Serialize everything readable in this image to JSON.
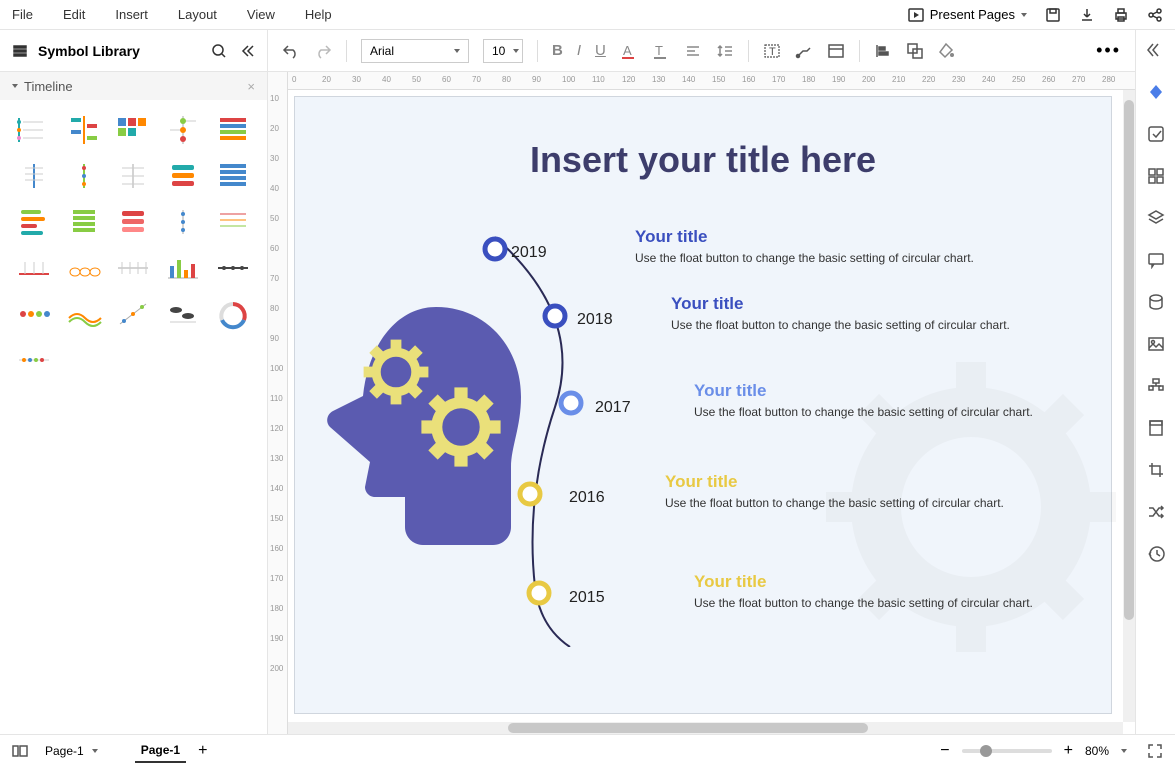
{
  "menu": {
    "file": "File",
    "edit": "Edit",
    "insert": "Insert",
    "layout": "Layout",
    "view": "View",
    "help": "Help"
  },
  "header": {
    "present": "Present Pages"
  },
  "sidebar": {
    "title": "Symbol Library",
    "panel": "Timeline"
  },
  "toolbar": {
    "font": "Arial",
    "size": "10"
  },
  "canvas": {
    "title": "Insert your title here",
    "entries": [
      {
        "year": "2019",
        "title": "Your title",
        "desc": "Use the float button to change the basic setting of circular chart.",
        "color": "#3a4fbf"
      },
      {
        "year": "2018",
        "title": "Your title",
        "desc": "Use the float button to change the basic setting of circular chart.",
        "color": "#3a4fbf"
      },
      {
        "year": "2017",
        "title": "Your title",
        "desc": "Use the float button to change the basic setting of circular chart.",
        "color": "#6a8ee8"
      },
      {
        "year": "2016",
        "title": "Your title",
        "desc": "Use the float button to change the basic setting of circular chart.",
        "color": "#e8c943"
      },
      {
        "year": "2015",
        "title": "Your title",
        "desc": "Use the float button to change the basic setting of circular chart.",
        "color": "#e8c943"
      }
    ]
  },
  "bottom": {
    "page_selector": "Page-1",
    "page_tab": "Page-1",
    "zoom": "80%"
  },
  "ruler_h": [
    "0",
    "20",
    "30",
    "40",
    "50",
    "60",
    "70",
    "80",
    "90",
    "100",
    "110",
    "120",
    "130",
    "140",
    "150",
    "160",
    "170",
    "180",
    "190",
    "200",
    "210",
    "220",
    "230",
    "240",
    "250",
    "260",
    "270",
    "280"
  ],
  "ruler_v": [
    "10",
    "20",
    "30",
    "40",
    "50",
    "60",
    "70",
    "80",
    "90",
    "100",
    "110",
    "120",
    "130",
    "140",
    "150",
    "160",
    "170",
    "180",
    "190",
    "200"
  ]
}
